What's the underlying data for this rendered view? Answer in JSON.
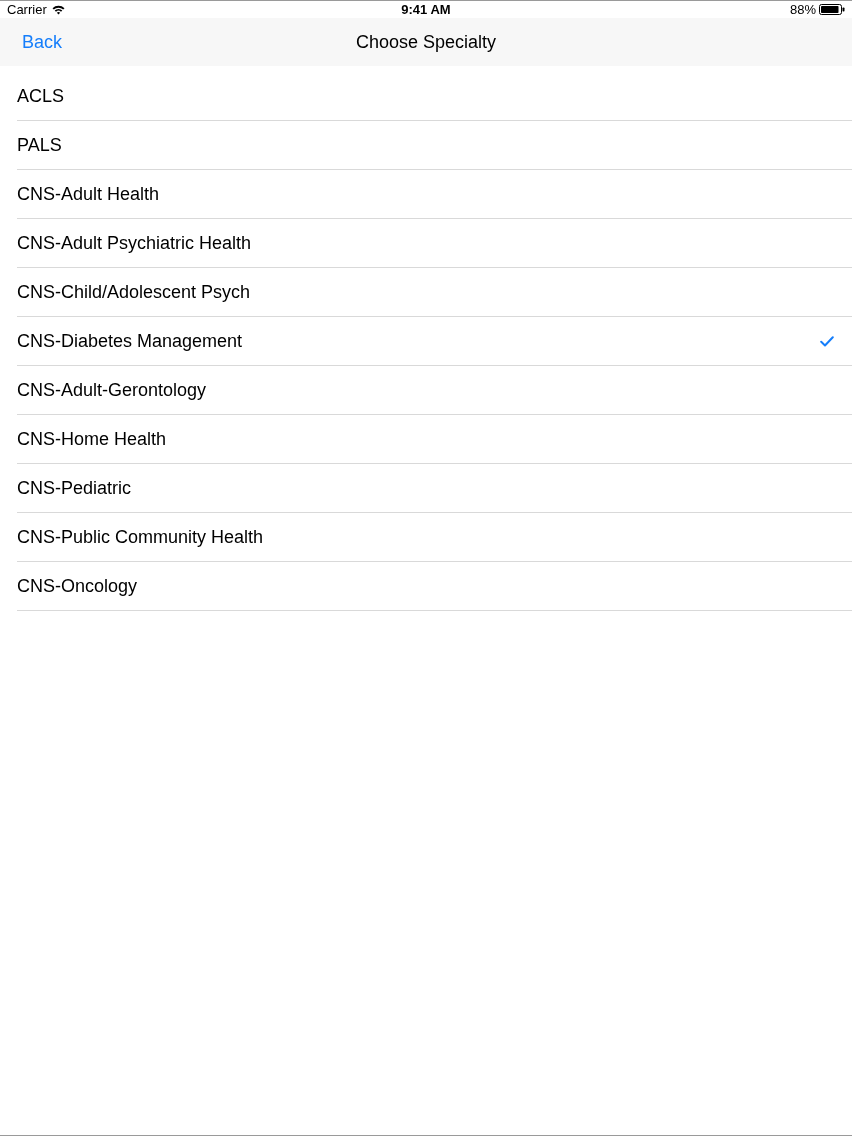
{
  "status_bar": {
    "carrier": "Carrier",
    "time": "9:41 AM",
    "battery": "88%"
  },
  "nav_bar": {
    "back": "Back",
    "title": "Choose Specialty"
  },
  "specialties": [
    {
      "label": "ACLS",
      "selected": false
    },
    {
      "label": "PALS",
      "selected": false
    },
    {
      "label": "CNS-Adult Health",
      "selected": false
    },
    {
      "label": "CNS-Adult Psychiatric Health",
      "selected": false
    },
    {
      "label": "CNS-Child/Adolescent Psych",
      "selected": false
    },
    {
      "label": "CNS-Diabetes Management",
      "selected": true
    },
    {
      "label": "CNS-Adult-Gerontology",
      "selected": false
    },
    {
      "label": "CNS-Home Health",
      "selected": false
    },
    {
      "label": "CNS-Pediatric",
      "selected": false
    },
    {
      "label": "CNS-Public Community Health",
      "selected": false
    },
    {
      "label": "CNS-Oncology",
      "selected": false
    }
  ]
}
